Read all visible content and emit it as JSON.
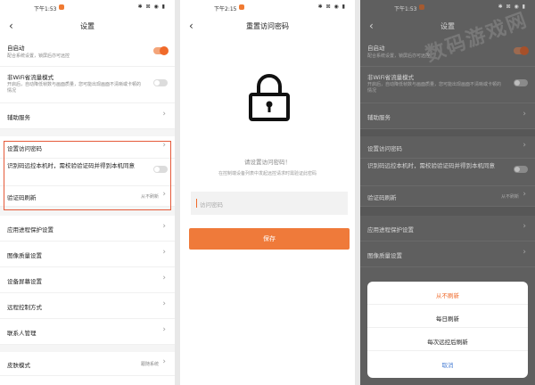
{
  "status": {
    "time_left": "下午1:53",
    "time_mid": "下午2:15",
    "time_right": "下午1:53",
    "icons": "✱ ⊠ ◉ ▮"
  },
  "left": {
    "title": "设置",
    "rows": {
      "autostart": {
        "label": "自启动",
        "sub": "配合系统设置，锁屏后亦可远控"
      },
      "nonwifi": {
        "label": "非WiFi省流量模式",
        "sub": "开启后，自动降低帧数与画面质量，您可能出现画面不清晰或卡顿的情况"
      },
      "assist": {
        "label": "辅助服务"
      },
      "password": {
        "label": "设置访问密码"
      },
      "verify": {
        "label": "识别码远控本机时，需校验验证码并得到本机同意"
      },
      "refresh": {
        "label": "验证码刷新",
        "value": "从不刷新"
      },
      "protect": {
        "label": "应用进程保护设置"
      },
      "quality": {
        "label": "图像质量设置"
      },
      "screen": {
        "label": "设备屏幕设置"
      },
      "control": {
        "label": "远程控制方式"
      },
      "contacts": {
        "label": "联系人管理"
      },
      "skin": {
        "label": "皮肤模式",
        "value": "跟随系统"
      }
    }
  },
  "middle": {
    "title": "重置访问密码",
    "prompt": "请设置访问密码！",
    "hint": "在控制端设备列表中发起远控请求时需验证此密码",
    "input_placeholder": "访问密码",
    "save_label": "保存"
  },
  "right": {
    "title": "设置",
    "watermark": "数码游戏网",
    "sheet": {
      "options": [
        "从不刷新",
        "每日刷新",
        "每次远控后刷新"
      ],
      "cancel": "取消"
    }
  },
  "colors": {
    "accent": "#ef7a3a",
    "highlight": "#e55a3a",
    "cancel": "#4a7fd4"
  }
}
